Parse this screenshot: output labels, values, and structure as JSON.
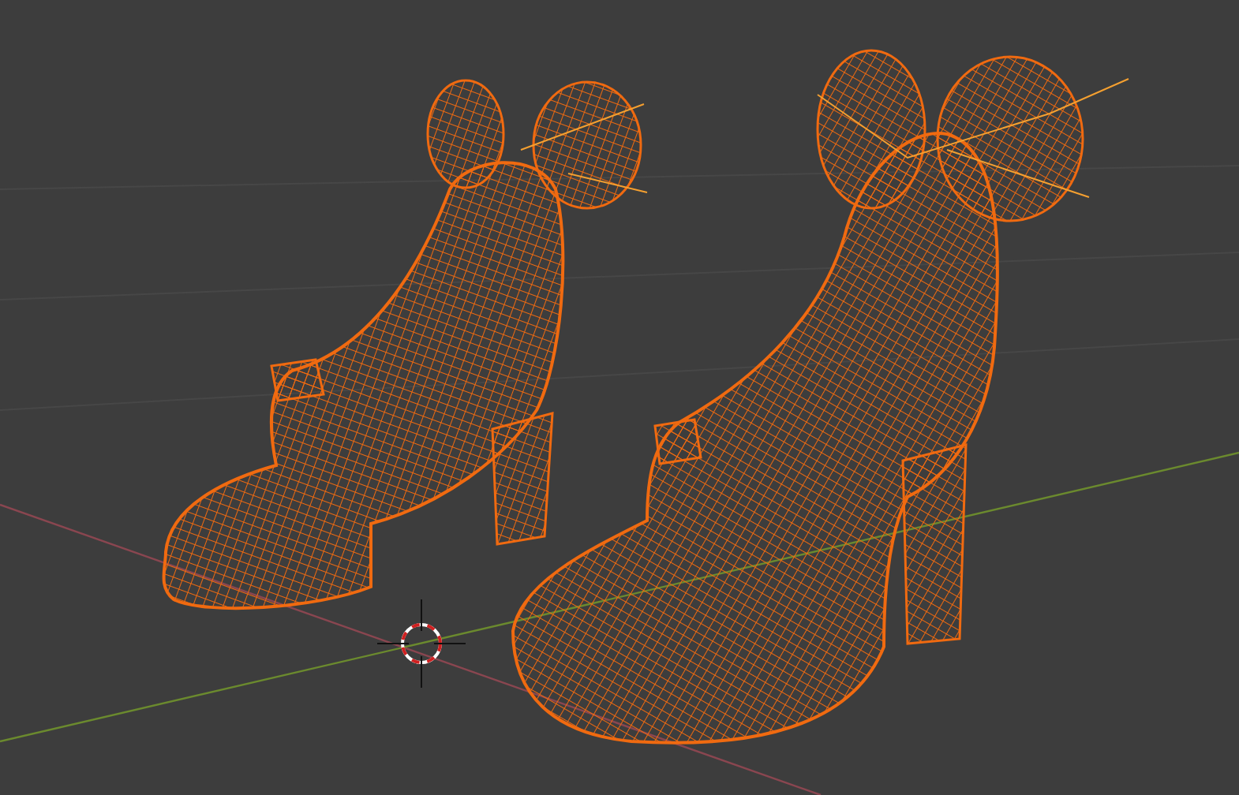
{
  "viewport": {
    "objects": [
      {
        "selected": true
      },
      {
        "selected": true
      }
    ]
  }
}
